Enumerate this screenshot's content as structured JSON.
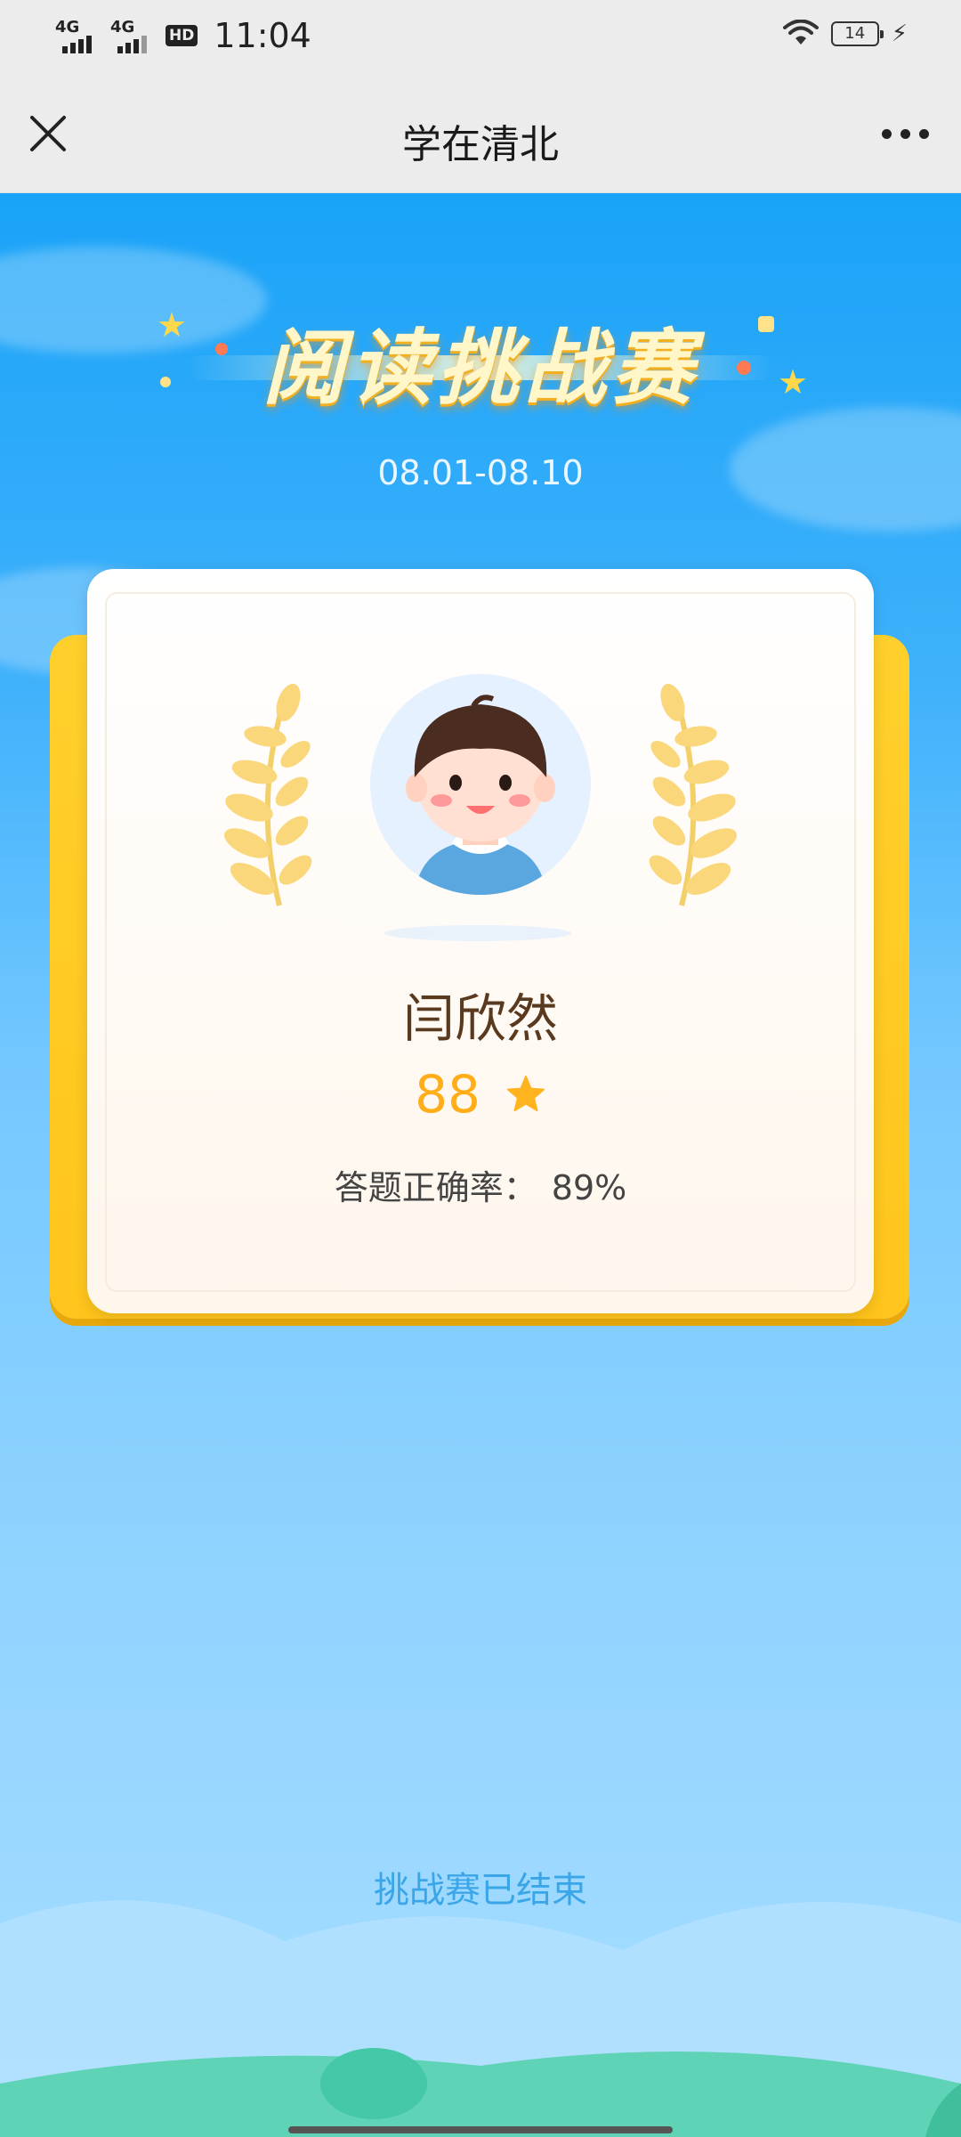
{
  "status_bar": {
    "network1": "4G",
    "network2": "4G",
    "hd": "HD",
    "time": "11:04",
    "battery": "14"
  },
  "nav": {
    "title": "学在清北",
    "close_icon": "close-icon",
    "more_icon": "more-icon"
  },
  "banner": {
    "title": "阅读挑战赛",
    "date_range": "08.01-08.10"
  },
  "card": {
    "name": "闫欣然",
    "score": "88",
    "accuracy_label": "答题正确率：",
    "accuracy_value": "89%"
  },
  "footer": {
    "status": "挑战赛已结束"
  },
  "colors": {
    "sky_top": "#1aa3f8",
    "card_gold": "#ffc51c",
    "score_gold": "#ffae1a",
    "name_brown": "#5a3a1e",
    "ended_blue": "#3aa6e8"
  }
}
